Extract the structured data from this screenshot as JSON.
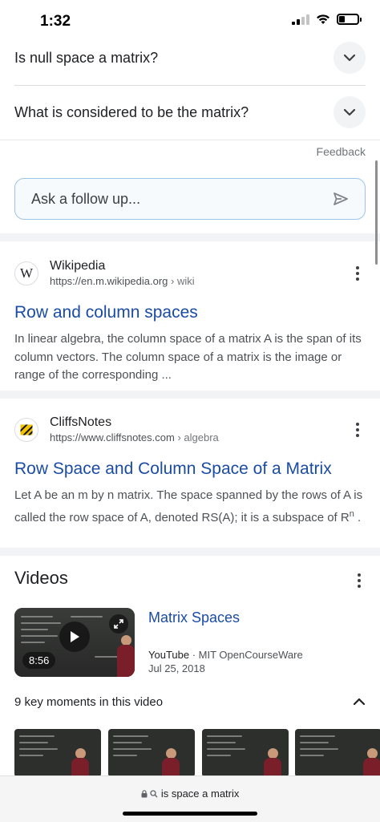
{
  "status": {
    "time": "1:32"
  },
  "faq": [
    {
      "question": "Is null space a matrix?"
    },
    {
      "question": "What is considered to be the matrix?"
    }
  ],
  "feedback_label": "Feedback",
  "followup": {
    "placeholder": "Ask a follow up..."
  },
  "results": [
    {
      "source": "Wikipedia",
      "favicon_letter": "W",
      "url": "https://en.m.wikipedia.org",
      "path": " › wiki",
      "title": "Row and column spaces",
      "snippet": "In linear algebra, the column space of a matrix A is the span of its column vectors. The column space of a matrix is the image or range of the corresponding ..."
    },
    {
      "source": "CliffsNotes",
      "url": "https://www.cliffsnotes.com",
      "path": " › algebra",
      "title": "Row Space and Column Space of a Matrix",
      "snippet": "Let A be an m by n matrix. The space spanned by the rows of A is called the row space of A, denoted RS(A); it is a subspace of R",
      "snippet_sup": "n",
      "snippet_end": " ."
    }
  ],
  "videos": {
    "heading": "Videos",
    "item": {
      "duration": "8:56",
      "title": "Matrix Spaces",
      "platform": "YouTube",
      "channel": " · MIT OpenCourseWare",
      "date": "Jul 25, 2018"
    },
    "key_moments_label": "9 key moments in this video"
  },
  "browser": {
    "url_text": "is space a matrix"
  },
  "icons": [
    "chevron-down-icon",
    "send-icon",
    "more-vert-icon",
    "play-icon",
    "expand-icon",
    "chevron-up-icon",
    "lock-icon",
    "search-icon"
  ]
}
